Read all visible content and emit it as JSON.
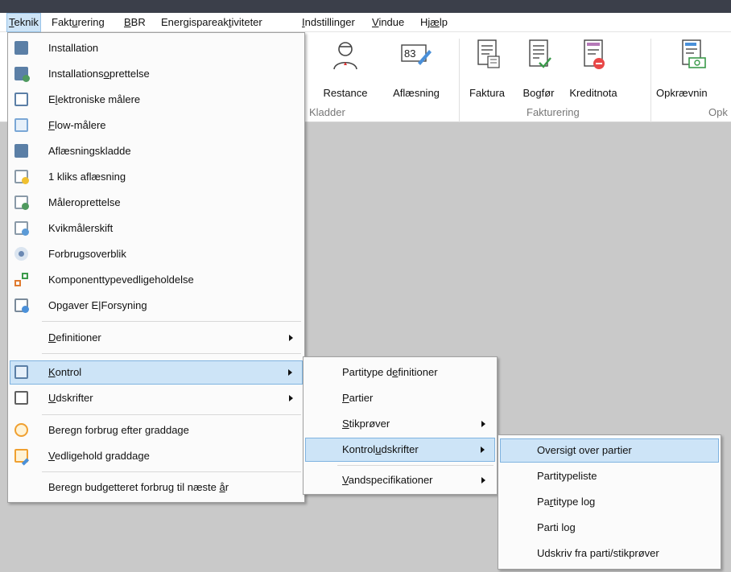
{
  "menubar": {
    "items": [
      {
        "pre": "",
        "ul": "T",
        "post": "eknik"
      },
      {
        "pre": "Fakt",
        "ul": "u",
        "post": "rering"
      },
      {
        "pre": "",
        "ul": "B",
        "post": "BR"
      },
      {
        "pre": "Energispareak",
        "ul": "t",
        "post": "iviteter"
      },
      {
        "pre": "",
        "ul": "I",
        "post": "ndstillinger"
      },
      {
        "pre": "",
        "ul": "V",
        "post": "indue"
      },
      {
        "pre": "Hj",
        "ul": "æ",
        "post": "lp"
      }
    ]
  },
  "ribbon": {
    "buttons": [
      "Restance",
      "Aflæsning",
      "Faktura",
      "Bogfør",
      "Kreditnota",
      "Opkrævnin"
    ],
    "groups": [
      "Kladder",
      "Fakturering",
      "Opk"
    ],
    "icons": [
      "person-icon",
      "meter-reading-icon",
      "invoice-icon",
      "book-check-icon",
      "credit-note-icon",
      "payment-request-icon"
    ]
  },
  "teknik_menu": {
    "items": [
      {
        "pre": "Installation",
        "ul": "",
        "post": "",
        "icon": "meter-icon",
        "color": "#5b7fa6"
      },
      {
        "pre": "Installations",
        "ul": "o",
        "post": "prettelse",
        "icon": "meter-add-icon",
        "color": "#4f9a5f"
      },
      {
        "pre": "E",
        "ul": "l",
        "post": "ektroniske målere",
        "icon": "calculator-icon",
        "color": "#5b7fa6"
      },
      {
        "pre": "",
        "ul": "F",
        "post": "low-målere",
        "icon": "flow-icon",
        "color": "#7aa7d6"
      },
      {
        "pre": "Aflæsningskladde",
        "ul": "",
        "post": "",
        "icon": "reading-icon",
        "color": "#5b7fa6"
      },
      {
        "pre": "1 kliks aflæsning",
        "ul": "",
        "post": "",
        "icon": "one-click-icon",
        "color": "#8a9aa8"
      },
      {
        "pre": "Måleroprettelse",
        "ul": "",
        "post": "",
        "icon": "meter-create-icon",
        "color": "#4f9a5f"
      },
      {
        "pre": "Kvikmålerskift",
        "ul": "",
        "post": "",
        "icon": "meter-swap-icon",
        "color": "#5b9ad6"
      },
      {
        "pre": "Forbrugsoverblik",
        "ul": "",
        "post": "",
        "icon": "eye-search-icon",
        "color": "#6b89b3"
      },
      {
        "pre": "Komponenttypevedligeholdelse",
        "ul": "",
        "post": "",
        "icon": "component-icon",
        "color": "#e07a2f"
      },
      {
        "pre": "Opgaver E|Forsyning",
        "ul": "",
        "post": "",
        "icon": "tasks-icon",
        "color": "#7a8a9a"
      },
      {
        "pre": "",
        "ul": "D",
        "post": "efinitioner",
        "icon": "",
        "color": ""
      },
      {
        "pre": "",
        "ul": "K",
        "post": "ontrol",
        "icon": "control-icon",
        "color": "#5b7fa6"
      },
      {
        "pre": "",
        "ul": "U",
        "post": "dskrifter",
        "icon": "printer-icon",
        "color": "#606060"
      },
      {
        "pre": "Beregn forbrug efter graddage",
        "ul": "",
        "post": "",
        "icon": "sun-icon",
        "color": "#f0a030"
      },
      {
        "pre": "",
        "ul": "V",
        "post": "edligehold graddage",
        "icon": "sun-edit-icon",
        "color": "#f0a030"
      },
      {
        "pre": "Beregn budgetteret forbrug til næste ",
        "ul": "å",
        "post": "r",
        "icon": "",
        "color": ""
      }
    ]
  },
  "kontrol_menu": {
    "items": [
      {
        "pre": "Partitype d",
        "ul": "e",
        "post": "finitioner"
      },
      {
        "pre": "",
        "ul": "P",
        "post": "artier"
      },
      {
        "pre": "",
        "ul": "S",
        "post": "tikprøver"
      },
      {
        "pre": "Kontrol",
        "ul": "u",
        "post": "dskrifter"
      },
      {
        "pre": "",
        "ul": "V",
        "post": "andspecifikationer"
      }
    ]
  },
  "udskrifter_menu": {
    "items": [
      {
        "pre": "Oversigt over partier",
        "ul": "",
        "post": ""
      },
      {
        "pre": "Partitypeliste",
        "ul": "",
        "post": ""
      },
      {
        "pre": "Pa",
        "ul": "r",
        "post": "titype log"
      },
      {
        "pre": "Parti lo",
        "ul": "g",
        "post": ""
      },
      {
        "pre": "Udskriv fra parti/stikprøver",
        "ul": "",
        "post": ""
      }
    ]
  }
}
